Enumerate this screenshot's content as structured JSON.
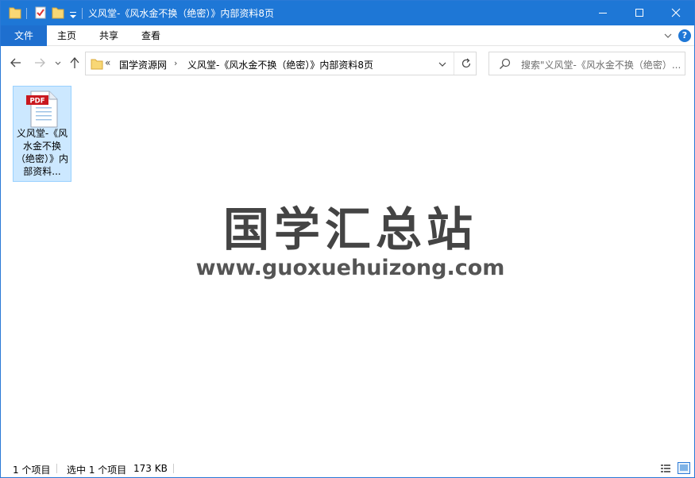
{
  "window": {
    "title": "义风堂-《风水金不换（绝密）》内部资料8页",
    "accent_color": "#1e77d6"
  },
  "ribbon": {
    "tabs": [
      {
        "label": "文件",
        "active": true
      },
      {
        "label": "主页"
      },
      {
        "label": "共享"
      },
      {
        "label": "查看"
      }
    ],
    "help_label": "?"
  },
  "navigation": {
    "overflow_chevron": "«",
    "breadcrumb": [
      "国学资源网",
      "义风堂-《风水金不换（绝密）》内部资料8页"
    ],
    "separator": "›",
    "search_placeholder": "搜索\"义风堂-《风水金不换（绝密）..."
  },
  "files": [
    {
      "name": "义风堂-《风水金不换（绝密）》内部资料...",
      "type": "pdf",
      "badge": "PDF",
      "selected": true
    }
  ],
  "watermark": {
    "chinese": "国学汇总站",
    "url": "www.guoxuehuizong.com"
  },
  "status": {
    "item_count": "1 个项目",
    "selected": "选中 1 个项目",
    "size": "173 KB"
  }
}
